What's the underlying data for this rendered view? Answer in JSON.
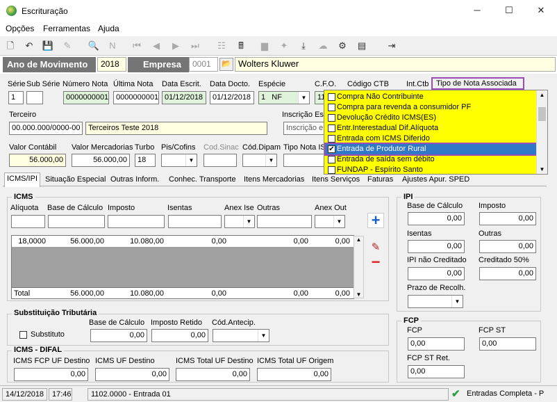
{
  "window": {
    "title": "Escrituração",
    "minimize": "─",
    "maximize": "☐",
    "close": "✕"
  },
  "menu": [
    "Opções",
    "Ferramentas",
    "Ajuda"
  ],
  "header": {
    "ano_label": "Ano de Movimento",
    "ano_value": "2018",
    "empresa_label": "Empresa",
    "empresa_code": "0001",
    "empresa_name": "Wolters Kluwer"
  },
  "row1": {
    "labels": {
      "serie": "Série",
      "subserie": "Sub Série",
      "numero": "Número Nota",
      "ultima": "Última Nota",
      "data_escrit": "Data Escrit.",
      "data_docto": "Data Docto.",
      "especie": "Espécie",
      "cfo": "C.F.O.",
      "codigo_ctb": "Código CTB",
      "int_ctb": "Int.Ctb",
      "tipo_nota": "Tipo de Nota Associada"
    },
    "serie": "1",
    "subserie": "",
    "numero": "0000000001",
    "ultima": "0000000001",
    "data_escrit": "01/12/2018",
    "data_docto": "01/12/2018",
    "especie_num": "1",
    "especie_txt": "NF",
    "cfo": "11"
  },
  "terceiro": {
    "label": "Terceiro",
    "cnpj": "00.000.000/0000-00",
    "nome": "Terceiros Teste 2018",
    "inscricao_label": "Inscrição Est",
    "inscricao_value": "Inscrição e"
  },
  "row3": {
    "labels": {
      "valor_contabil": "Valor Contábil",
      "valor_mercadorias": "Valor Mercadorias",
      "turbo": "Turbo",
      "pis": "Pis/Cofins",
      "cod_sinac": "Cod.Sinac",
      "cod_dipam": "Cód.Dipam",
      "tipo_nota_is": "Tipo Nota IS"
    },
    "valor_contabil": "56.000,00",
    "valor_mercadorias": "56.000,00",
    "turbo": "18"
  },
  "dropdown": {
    "items": [
      {
        "label": "Compra Não Contribuinte",
        "checked": false
      },
      {
        "label": "Compra para revenda a consumidor PF",
        "checked": false
      },
      {
        "label": "Devolução Crédito ICMS(ES)",
        "checked": false
      },
      {
        "label": "Entr.Interestadual Dif.Alíquota",
        "checked": false
      },
      {
        "label": "Entrada com ICMS Diferido",
        "checked": false
      },
      {
        "label": "Entrada de Produtor Rural",
        "checked": true
      },
      {
        "label": "Entrada de saída sem débito",
        "checked": false
      },
      {
        "label": "FUNDAP - Espírito Santo",
        "checked": false
      }
    ]
  },
  "tabs": [
    "ICMS/IPI",
    "Situação Especial",
    "Outras Inform.",
    "Conhec. Transporte",
    "Itens Mercadorias",
    "Itens Serviços",
    "Faturas",
    "Ajustes Apur. SPED"
  ],
  "icms": {
    "title": "ICMS",
    "labels": {
      "aliquota": "Alíquota",
      "base": "Base de Cálculo",
      "imposto": "Imposto",
      "isentas": "Isentas",
      "anex_ise": "Anex Ise",
      "outras": "Outras",
      "anex_out": "Anex Out"
    },
    "rows": [
      {
        "aliquota": "18,0000",
        "base": "56.000,00",
        "imposto": "10.080,00",
        "isentas": "0,00",
        "outras": "0,00",
        "extra": "0,00"
      }
    ],
    "total": {
      "label": "Total",
      "base": "56.000,00",
      "imposto": "10.080,00",
      "isentas": "0,00",
      "outras": "0,00",
      "extra": "0,00"
    }
  },
  "st": {
    "title": "Substituição Tributária",
    "substituto_label": "Substituto",
    "base_label": "Base de Cálculo",
    "base": "0,00",
    "retido_label": "Imposto Retido",
    "retido": "0,00",
    "cod_label": "Cód.Antecip."
  },
  "difal": {
    "title": "ICMS - DIFAL",
    "labels": [
      "ICMS FCP UF Destino",
      "ICMS UF Destino",
      "ICMS Total UF Destino",
      "ICMS Total UF Origem"
    ],
    "values": [
      "0,00",
      "0,00",
      "0,00",
      "0,00"
    ]
  },
  "ipi": {
    "title": "IPI",
    "base_label": "Base de Cálculo",
    "base": "0,00",
    "imposto_label": "Imposto",
    "imposto": "0,00",
    "isentas_label": "Isentas",
    "isentas": "0,00",
    "outras_label": "Outras",
    "outras": "0,00",
    "nao_cred_label": "IPI não Creditado",
    "nao_cred": "0,00",
    "cred50_label": "Creditado 50%",
    "cred50": "0,00",
    "prazo_label": "Prazo de Recolh."
  },
  "fcp": {
    "title": "FCP",
    "fcp_label": "FCP",
    "fcp": "0,00",
    "fcpst_label": "FCP ST",
    "fcpst": "0,00",
    "fcpstret_label": "FCP ST Ret.",
    "fcpstret": "0,00"
  },
  "status": {
    "date": "14/12/2018",
    "time": "17:46",
    "info": "1102.0000 - Entrada 01",
    "mode": "Entradas Completa - P"
  }
}
